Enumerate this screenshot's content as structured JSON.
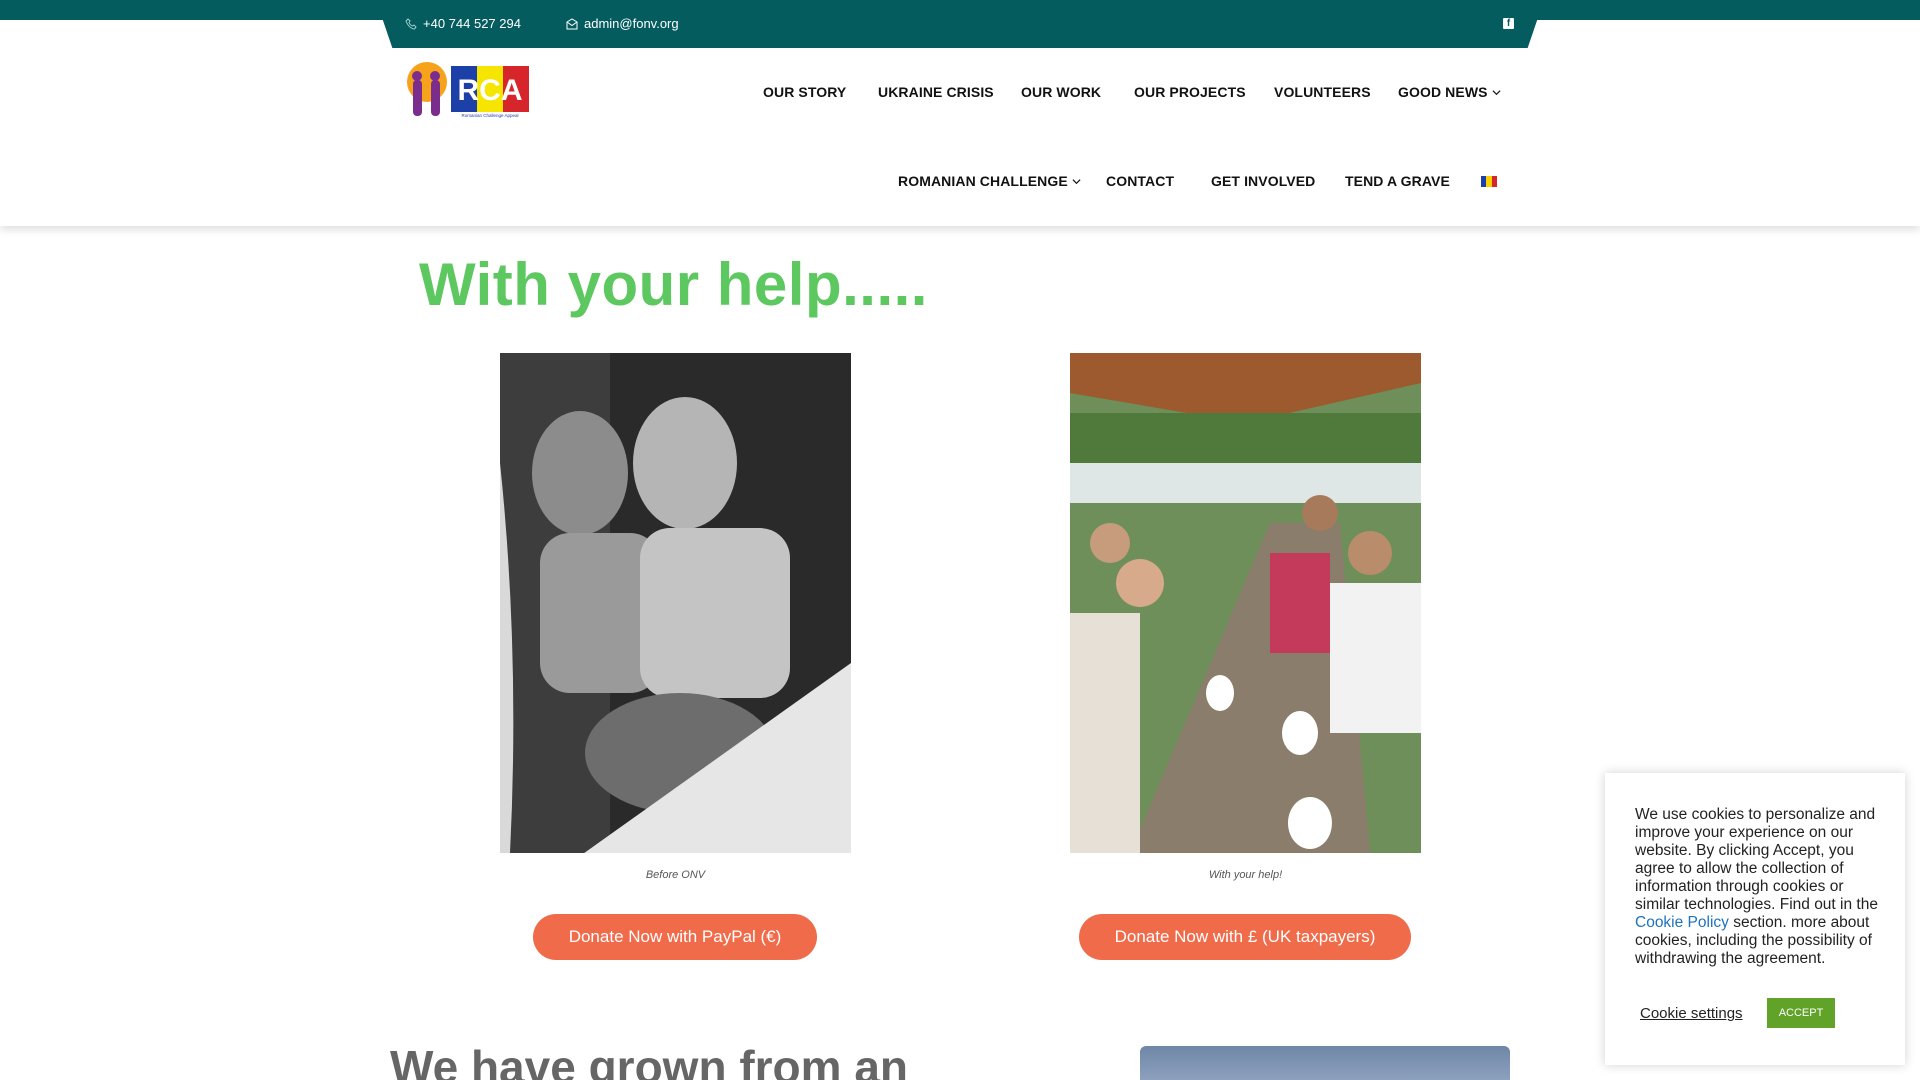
{
  "topbar": {
    "phone": "+40 744 527 294",
    "email": "admin@fonv.org",
    "social_icon": "facebook-icon"
  },
  "nav": {
    "row1": [
      "OUR STORY",
      "UKRAINE CRISIS",
      "OUR WORK",
      "OUR PROJECTS",
      "VOLUNTEERS",
      "GOOD NEWS"
    ],
    "row2": [
      "ROMANIAN CHALLENGE",
      "CONTACT",
      "GET INVOLVED",
      "TEND A GRAVE"
    ],
    "language_flag": "romanian-flag-icon"
  },
  "logo": {
    "letters": "RCA",
    "subtitle": "Romanian Challenge Appeal"
  },
  "main": {
    "headline": "With your help.....",
    "left_caption": "Before ONV",
    "right_caption": "With your help!",
    "left_button": "Donate Now with PayPal (€)",
    "right_button": "Donate Now with £ (UK taxpayers)",
    "bottom_heading": "We have grown from an"
  },
  "cookie": {
    "text_before_link": "We use cookies to personalize and improve your experience on our website. By clicking Accept, you agree to allow the collection of information through cookies or similar technologies. Find out in the",
    "link": "Cookie Policy",
    "text_after_link": "section. more about cookies, including the possibility of withdrawing the agreement.",
    "settings_label": "Cookie settings",
    "accept_label": "ACCEPT"
  },
  "colors": {
    "topbar": "#055c5e",
    "headline": "#5cc85f",
    "donate": "#f06b4a",
    "accept": "#61a229",
    "link": "#1e73be"
  }
}
